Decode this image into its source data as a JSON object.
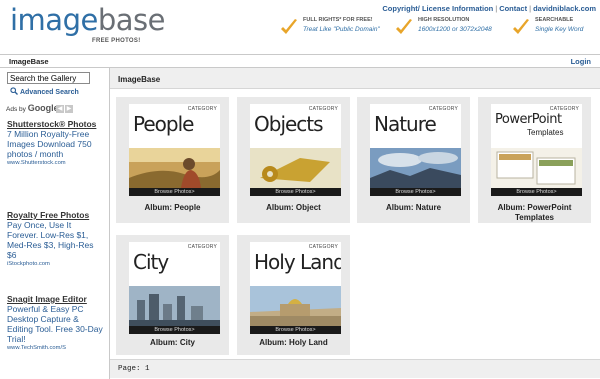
{
  "header": {
    "logo_part1": "image",
    "logo_part2": "base",
    "logo_sub": "FREE PHOTOS!",
    "links": [
      "Copyright/ License Information",
      "Contact",
      "davidniblack.com"
    ],
    "features": [
      {
        "title": "FULL RIGHTS* FOR FREE!",
        "sub": "Treat Like \"Public Domain\"",
        "icon": "checkmark-icon"
      },
      {
        "title": "HIGH RESOLUTION",
        "sub": "1600x1200 or 3072x2048",
        "icon": "checkmark-icon"
      },
      {
        "title": "SEARCHABLE",
        "sub": "Single Key Word",
        "icon": "checkmark-icon"
      }
    ],
    "accent": "#e8a52a"
  },
  "nav": {
    "title": "ImageBase",
    "login": "Login"
  },
  "sidebar": {
    "search_value": "Search the Gallery",
    "advanced_search": "Advanced Search",
    "ads_by": "Ads by",
    "google": "Google",
    "ads": [
      {
        "title": "Shutterstock® Photos",
        "body": "7 Million Royalty-Free Images Download 750 photos / month",
        "url": "www.Shutterstock.com"
      },
      {
        "title": "Royalty Free Photos",
        "body": "Pay Once, Use It Forever. Low-Res $1, Med-Res $3, High-Res $6",
        "url": "iStockphoto.com"
      },
      {
        "title": "Snagit Image Editor",
        "body": "Powerful & Easy PC Desktop Capture & Editing Tool. Free 30-Day Trial!",
        "url": "www.TechSmith.com/S"
      }
    ]
  },
  "main": {
    "title": "ImageBase",
    "category_label": "CATEGORY",
    "browse_label": "Browse Photos>",
    "albums": [
      {
        "name": "People",
        "label": "Album: People"
      },
      {
        "name": "Objects",
        "label": "Album: Object"
      },
      {
        "name": "Nature",
        "label": "Album: Nature"
      },
      {
        "name": "PowerPoint",
        "name2": "Templates",
        "label": "Album: PowerPoint Templates"
      },
      {
        "name": "City",
        "label": "Album: City"
      },
      {
        "name": "Holy Land",
        "label": "Album: Holy Land"
      }
    ],
    "pager": "Page: 1"
  },
  "colors": {
    "link": "#2a5d95",
    "brand_blue": "#2f6fa6",
    "tile_bg": "#e9e9e9"
  }
}
